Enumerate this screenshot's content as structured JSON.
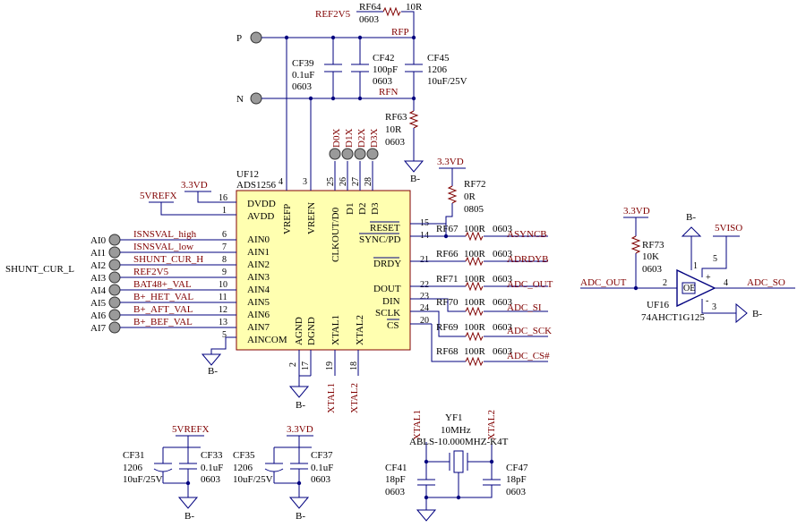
{
  "colors": {
    "wire": "#00007f",
    "net_label": "#800000",
    "chip_fill": "#ffffb0",
    "background": "#ffffff"
  },
  "nets": {
    "ref2v5": "REF2V5",
    "rfp": "RFP",
    "rfn": "RFN",
    "gnd": "B-",
    "v3v3": "3.3VD",
    "v5vrefx": "5VREFX",
    "xtal1": "XTAL1",
    "xtal2": "XTAL2"
  },
  "ports": {
    "p": "P",
    "n": "N"
  },
  "test_points": [
    "D0X",
    "D1X",
    "D2X",
    "D3X"
  ],
  "shunt_label": "SHUNT_CUR_L",
  "components": {
    "rf64": {
      "ref": "RF64",
      "value": "10R",
      "package": "0603"
    },
    "rf63": {
      "ref": "RF63",
      "value": "10R",
      "package": "0603"
    },
    "rf72": {
      "ref": "RF72",
      "value": "0R",
      "package": "0805"
    },
    "rf73": {
      "ref": "RF73",
      "value": "10K",
      "package": "0603"
    },
    "cf39": {
      "ref": "CF39",
      "value": "0.1uF",
      "package": "0603"
    },
    "cf42": {
      "ref": "CF42",
      "value": "100pF",
      "package": "0603"
    },
    "cf45": {
      "ref": "CF45",
      "value": "10uF/25V",
      "package": "1206"
    },
    "cf31": {
      "ref": "CF31",
      "value": "10uF/25V",
      "package": "1206"
    },
    "cf33": {
      "ref": "CF33",
      "value": "0.1uF",
      "package": "0603"
    },
    "cf35": {
      "ref": "CF35",
      "value": "10uF/25V",
      "package": "1206"
    },
    "cf37": {
      "ref": "CF37",
      "value": "0.1uF",
      "package": "0603"
    },
    "cf41": {
      "ref": "CF41",
      "value": "18pF",
      "package": "0603"
    },
    "cf47": {
      "ref": "CF47",
      "value": "18pF",
      "package": "0603"
    }
  },
  "chip": {
    "ref": "UF12",
    "part": "ADS1256",
    "left_pins": [
      {
        "name": "DVDD",
        "num": "16"
      },
      {
        "name": "AVDD",
        "num": "1"
      },
      {
        "name": "AIN0",
        "num": "6"
      },
      {
        "name": "AIN1",
        "num": "7"
      },
      {
        "name": "AIN2",
        "num": "8"
      },
      {
        "name": "AIN3",
        "num": "9"
      },
      {
        "name": "AIN4",
        "num": "10"
      },
      {
        "name": "AIN5",
        "num": "11"
      },
      {
        "name": "AIN6",
        "num": "12"
      },
      {
        "name": "AIN7",
        "num": "13"
      },
      {
        "name": "AINCOM",
        "num": "5"
      }
    ],
    "right_pins": [
      {
        "name": "RESET",
        "num": "15"
      },
      {
        "name": "SYNC/PD",
        "num": "14"
      },
      {
        "name": "DRDY",
        "num": "21"
      },
      {
        "name": "DOUT",
        "num": "22"
      },
      {
        "name": "DIN",
        "num": "23"
      },
      {
        "name": "SCLK",
        "num": "24"
      },
      {
        "name": "CS",
        "num": "20"
      }
    ],
    "top_pins": [
      {
        "name": "VREFP",
        "num": "4"
      },
      {
        "name": "VREFN",
        "num": "3"
      },
      {
        "name": "CLKOUT/D0",
        "num": "25"
      },
      {
        "name": "D1",
        "num": "26"
      },
      {
        "name": "D2",
        "num": "27"
      },
      {
        "name": "D3",
        "num": "28"
      }
    ],
    "bottom_pins": [
      {
        "name": "AGND",
        "num": "2"
      },
      {
        "name": "DGND",
        "num": "17"
      },
      {
        "name": "XTAL1",
        "num": "19"
      },
      {
        "name": "XTAL2",
        "num": "18"
      }
    ]
  },
  "analog_inputs": [
    {
      "port": "AI0",
      "net": "ISNSVAL_high"
    },
    {
      "port": "AI1",
      "net": "ISNSVAL_low"
    },
    {
      "port": "AI2",
      "net": "SHUNT_CUR_H"
    },
    {
      "port": "AI3",
      "net": "REF2V5"
    },
    {
      "port": "AI4",
      "net": "BAT48+_VAL"
    },
    {
      "port": "AI5",
      "net": "B+_HET_VAL"
    },
    {
      "port": "AI6",
      "net": "B+_AFT_VAL"
    },
    {
      "port": "AI7",
      "net": "B+_BEF_VAL"
    }
  ],
  "resistors": [
    {
      "ref": "RF67",
      "value": "100R",
      "package": "0603",
      "net": "ASYNCB"
    },
    {
      "ref": "RF66",
      "value": "100R",
      "package": "0603",
      "net": "ADRDYB"
    },
    {
      "ref": "RF71",
      "value": "100R",
      "package": "0603",
      "net": "ADC_OUT"
    },
    {
      "ref": "RF70",
      "value": "100R",
      "package": "0603",
      "net": "ADC_SI"
    },
    {
      "ref": "RF69",
      "value": "100R",
      "package": "0603",
      "net": "ADC_SCK"
    },
    {
      "ref": "RF68",
      "value": "100R",
      "package": "0603",
      "net": "ADC_CS#"
    }
  ],
  "buffer": {
    "ref": "UF16",
    "part": "74AHCT1G125",
    "input_net": "ADC_OUT",
    "output_net": "ADC_SO",
    "supply": "5VISO",
    "oe": "OE",
    "plus": "+",
    "minus": "-",
    "pins": [
      "2",
      "1",
      "5",
      "4",
      "3"
    ]
  },
  "crystal": {
    "ref": "YF1",
    "freq": "10MHz",
    "part": "ABLS-10.000MHZ-K4T"
  }
}
